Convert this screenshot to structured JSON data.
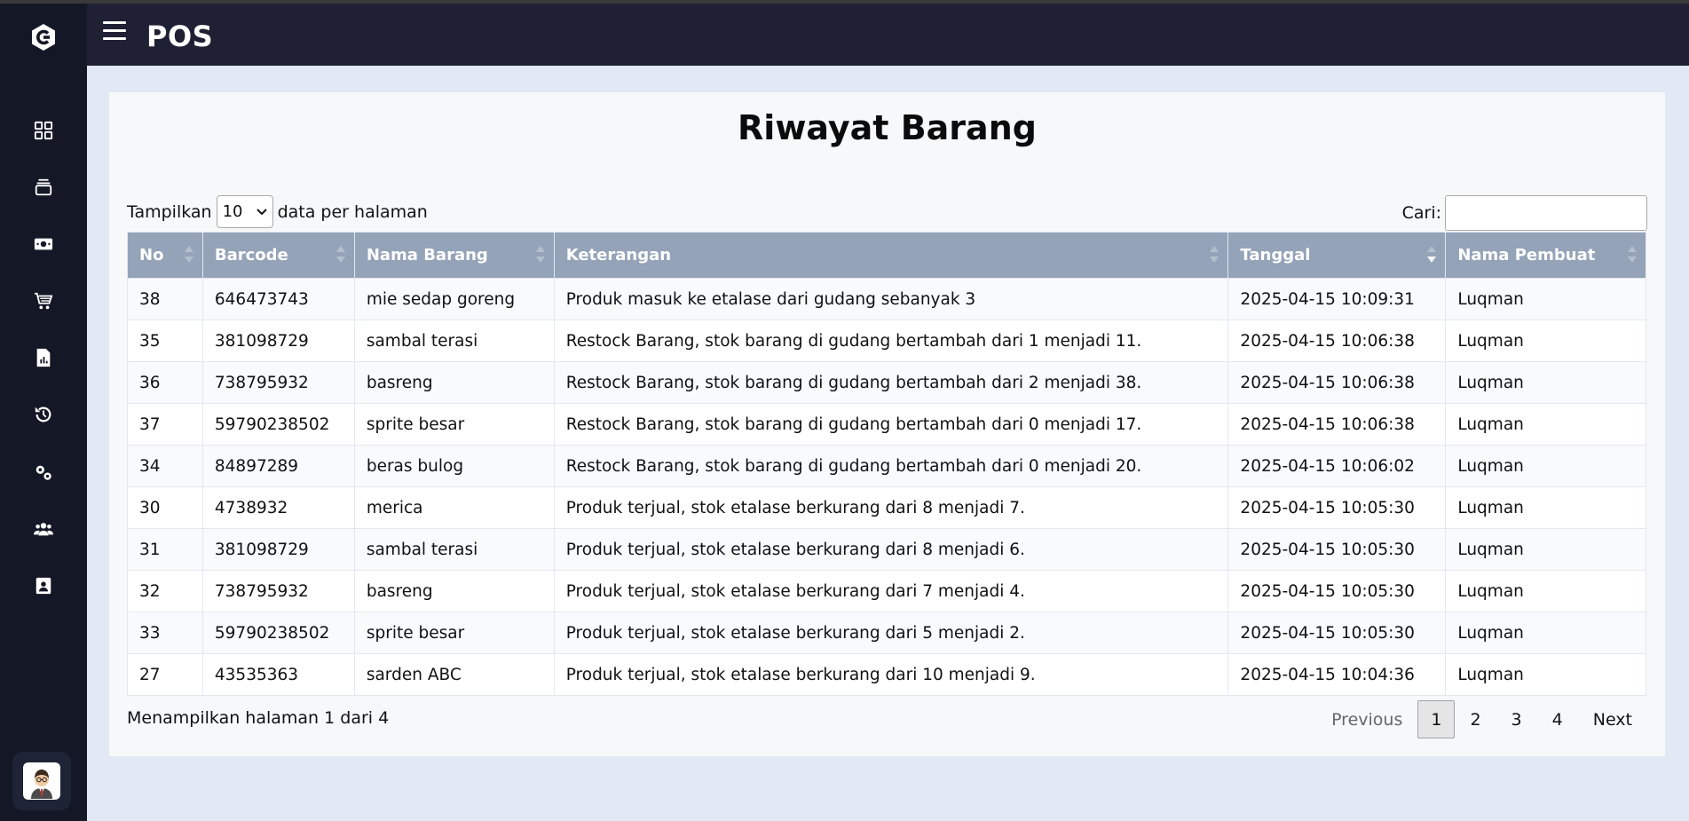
{
  "app": {
    "title": "POS"
  },
  "sidebar": {
    "items": [
      {
        "icon": "dashboard-icon"
      },
      {
        "icon": "products-icon"
      },
      {
        "icon": "money-icon"
      },
      {
        "icon": "cart-icon"
      },
      {
        "icon": "report-icon"
      },
      {
        "icon": "history-icon"
      },
      {
        "icon": "settings-icon"
      },
      {
        "icon": "users-icon"
      },
      {
        "icon": "profile-card-icon"
      }
    ]
  },
  "main": {
    "title": "Riwayat Barang",
    "length_prefix": "Tampilkan",
    "length_value": "10",
    "length_suffix": "data per halaman",
    "search_label": "Cari:",
    "search_value": "",
    "columns": [
      "No",
      "Barcode",
      "Nama Barang",
      "Keterangan",
      "Tanggal",
      "Nama Pembuat"
    ],
    "rows": [
      [
        "38",
        "646473743",
        "mie sedap goreng",
        "Produk masuk ke etalase dari gudang sebanyak 3",
        "2025-04-15 10:09:31",
        "Luqman"
      ],
      [
        "35",
        "381098729",
        "sambal terasi",
        "Restock Barang, stok barang di gudang bertambah dari 1 menjadi 11.",
        "2025-04-15 10:06:38",
        "Luqman"
      ],
      [
        "36",
        "738795932",
        "basreng",
        "Restock Barang, stok barang di gudang bertambah dari 2 menjadi 38.",
        "2025-04-15 10:06:38",
        "Luqman"
      ],
      [
        "37",
        "59790238502",
        "sprite besar",
        "Restock Barang, stok barang di gudang bertambah dari 0 menjadi 17.",
        "2025-04-15 10:06:38",
        "Luqman"
      ],
      [
        "34",
        "84897289",
        "beras bulog",
        "Restock Barang, stok barang di gudang bertambah dari 0 menjadi 20.",
        "2025-04-15 10:06:02",
        "Luqman"
      ],
      [
        "30",
        "4738932",
        "merica",
        "Produk terjual, stok etalase berkurang dari 8 menjadi 7.",
        "2025-04-15 10:05:30",
        "Luqman"
      ],
      [
        "31",
        "381098729",
        "sambal terasi",
        "Produk terjual, stok etalase berkurang dari 8 menjadi 6.",
        "2025-04-15 10:05:30",
        "Luqman"
      ],
      [
        "32",
        "738795932",
        "basreng",
        "Produk terjual, stok etalase berkurang dari 7 menjadi 4.",
        "2025-04-15 10:05:30",
        "Luqman"
      ],
      [
        "33",
        "59790238502",
        "sprite besar",
        "Produk terjual, stok etalase berkurang dari 5 menjadi 2.",
        "2025-04-15 10:05:30",
        "Luqman"
      ],
      [
        "27",
        "43535363",
        "sarden ABC",
        "Produk terjual, stok etalase berkurang dari 10 menjadi 9.",
        "2025-04-15 10:04:36",
        "Luqman"
      ]
    ],
    "info": "Menampilkan halaman 1 dari 4",
    "pagination": {
      "previous": "Previous",
      "pages": [
        "1",
        "2",
        "3",
        "4"
      ],
      "current": "1",
      "next": "Next"
    }
  }
}
